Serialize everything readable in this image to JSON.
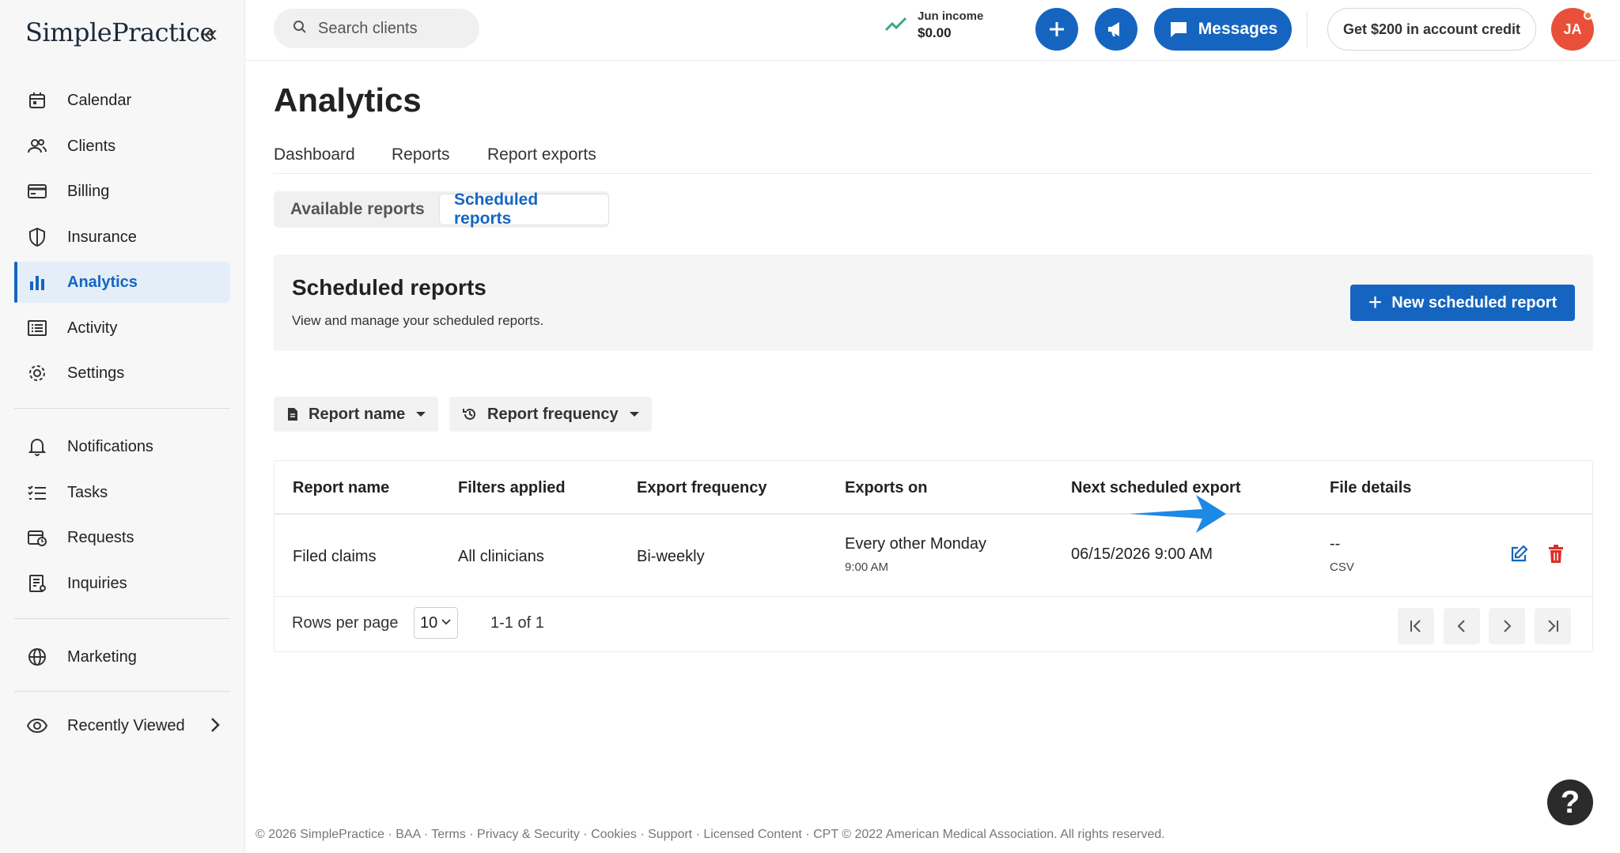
{
  "app": {
    "logo_text": "SimplePractice"
  },
  "sidebar": {
    "items": [
      {
        "label": "Calendar"
      },
      {
        "label": "Clients"
      },
      {
        "label": "Billing"
      },
      {
        "label": "Insurance"
      },
      {
        "label": "Analytics"
      },
      {
        "label": "Activity"
      },
      {
        "label": "Settings"
      },
      {
        "label": "Notifications"
      },
      {
        "label": "Tasks"
      },
      {
        "label": "Requests"
      },
      {
        "label": "Inquiries"
      },
      {
        "label": "Marketing"
      },
      {
        "label": "Recently Viewed"
      }
    ]
  },
  "topbar": {
    "search_placeholder": "Search clients",
    "income_label": "Jun income",
    "income_value": "$0.00",
    "messages_label": "Messages",
    "credit_label": "Get $200 in account credit",
    "avatar_initials": "JA"
  },
  "main": {
    "title": "Analytics",
    "tabs": [
      {
        "label": "Dashboard"
      },
      {
        "label": "Reports"
      },
      {
        "label": "Report exports"
      }
    ],
    "segments": [
      {
        "label": "Available reports"
      },
      {
        "label": "Scheduled reports"
      }
    ],
    "panel": {
      "title": "Scheduled reports",
      "subtitle": "View and manage your scheduled reports.",
      "new_button": "New scheduled report"
    },
    "filters": [
      {
        "label": "Report name"
      },
      {
        "label": "Report frequency"
      }
    ],
    "table": {
      "headers": [
        "Report name",
        "Filters applied",
        "Export frequency",
        "Exports on",
        "Next scheduled export",
        "File details"
      ],
      "rows": [
        {
          "report_name": "Filed claims",
          "filters": "All clinicians",
          "frequency": "Bi-weekly",
          "exports_on": "Every other Monday",
          "exports_on_time": "9:00 AM",
          "next_export": "06/15/2026 9:00 AM",
          "file_details": "--",
          "file_type": "CSV"
        }
      ],
      "rows_per_page_label": "Rows per page",
      "rows_per_page_value": "10",
      "range_text": "1-1 of 1"
    }
  },
  "footer": {
    "text": "© 2026 SimplePractice · BAA · Terms · Privacy & Security · Cookies · Support · Licensed Content · CPT © 2022 American Medical Association. All rights reserved."
  },
  "help_label": "?",
  "colors": {
    "accent": "#1565c0",
    "danger": "#d93025",
    "avatar": "#e8503a"
  }
}
